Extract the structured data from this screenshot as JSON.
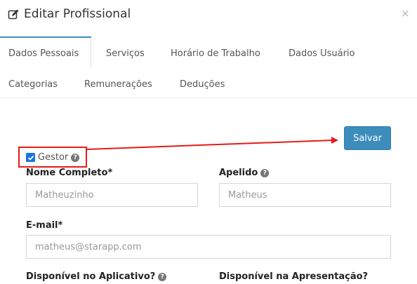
{
  "header": {
    "title": "Editar Profissional",
    "close_label": "×"
  },
  "tabs": [
    {
      "label": "Dados Pessoais",
      "active": true
    },
    {
      "label": "Serviços"
    },
    {
      "label": "Horário de Trabalho"
    },
    {
      "label": "Dados Usuário"
    },
    {
      "label": "Categorias"
    },
    {
      "label": "Remunerações"
    },
    {
      "label": "Deduções"
    }
  ],
  "actions": {
    "save_label": "Salvar"
  },
  "gestor": {
    "label": "Gestor",
    "checked": true
  },
  "form": {
    "nome_completo": {
      "label": "Nome Completo*",
      "placeholder": "Matheuzinho"
    },
    "apelido": {
      "label": "Apelido",
      "placeholder": "Matheus"
    },
    "email": {
      "label": "E-mail*",
      "placeholder": "matheus@starapp.com"
    },
    "disponivel_aplicativo": {
      "label": "Disponível no Aplicativo?"
    },
    "disponivel_apresentacao": {
      "label": "Disponível na Apresentação?"
    }
  },
  "colors": {
    "accent": "#3c8dbc",
    "annotation": "#e51b1b",
    "checkbox": "#1a73e8"
  },
  "icons": {
    "title": "edit-icon",
    "help": "question-circle-icon",
    "check": "check-icon"
  }
}
